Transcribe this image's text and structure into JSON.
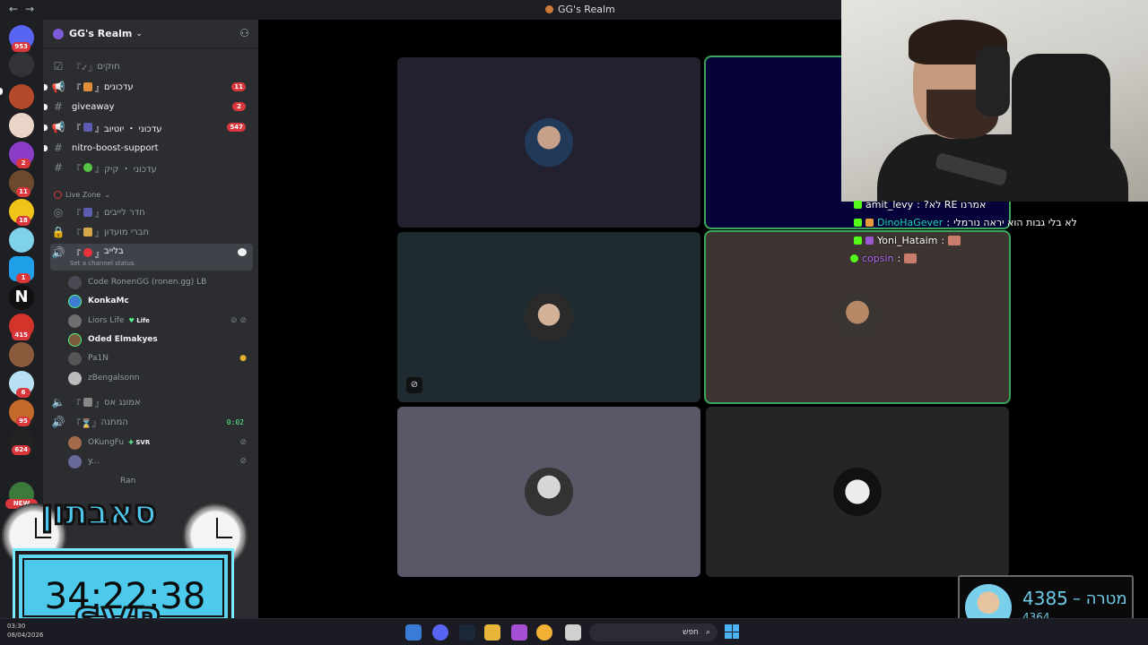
{
  "window": {
    "title": "GG's Realm"
  },
  "rail": {
    "badges": [
      "953",
      "2",
      "11",
      "18",
      "1",
      "415",
      "6",
      "95",
      "624"
    ],
    "new_label": "NEW",
    "text_server": "N"
  },
  "server": {
    "name": "GG's Realm"
  },
  "channels": [
    {
      "name": "חוקים",
      "badge": ""
    },
    {
      "name": "עדכונים",
      "badge": "11"
    },
    {
      "name": "giveaway",
      "badge": "2"
    },
    {
      "name": "עדכוני ・ יוטיוב",
      "badge": "547"
    },
    {
      "name": "nitro-boost-support",
      "badge": ""
    },
    {
      "name": "עדכוני ・ קיק",
      "badge": ""
    }
  ],
  "live_zone": {
    "category": "Live Zone",
    "channels": [
      "חדר לייבים",
      "חברי מועדון"
    ],
    "active_channel": "בלייב",
    "status_placeholder": "Set a channel status"
  },
  "voice_users": [
    {
      "name": "Code RonenGG (ronen.gg) LB"
    },
    {
      "name": "KonkaMc"
    },
    {
      "name": "Liors Life",
      "tag": "Life"
    },
    {
      "name": "Oded Elmakyes"
    },
    {
      "name": "Pa1N"
    },
    {
      "name": "zBengalsonn"
    }
  ],
  "other_voice": {
    "channel1": "אמונג אס",
    "channel2": "המתנה",
    "channel2_time": "0:02",
    "users": [
      {
        "name": "OKungFu",
        "tag": "SVR"
      },
      {
        "name": "y..."
      },
      {
        "name": "Ran"
      }
    ]
  },
  "overlay": {
    "logo_text": "סאבתון",
    "timer": "34:22:38",
    "brand": "SVR"
  },
  "chat": [
    {
      "user": "amit_levy",
      "message": "?לא RE אמרנו",
      "user_color": "#ffffff"
    },
    {
      "user": "DinoHaGever",
      "message": "לא בלי גבות הוא יראה נורמלי",
      "user_color": "#1ad6c9"
    },
    {
      "user": "Yoni_Hataim",
      "message": "",
      "user_color": "#ffffff"
    },
    {
      "user": "copsin",
      "message": "",
      "user_color": "#b06ef0"
    }
  ],
  "goal": {
    "count": "4385",
    "label": "מטרה",
    "current": "4364"
  },
  "taskbar": {
    "time": "03:30",
    "date": "08/04/2026",
    "search_placeholder": "חפש"
  }
}
